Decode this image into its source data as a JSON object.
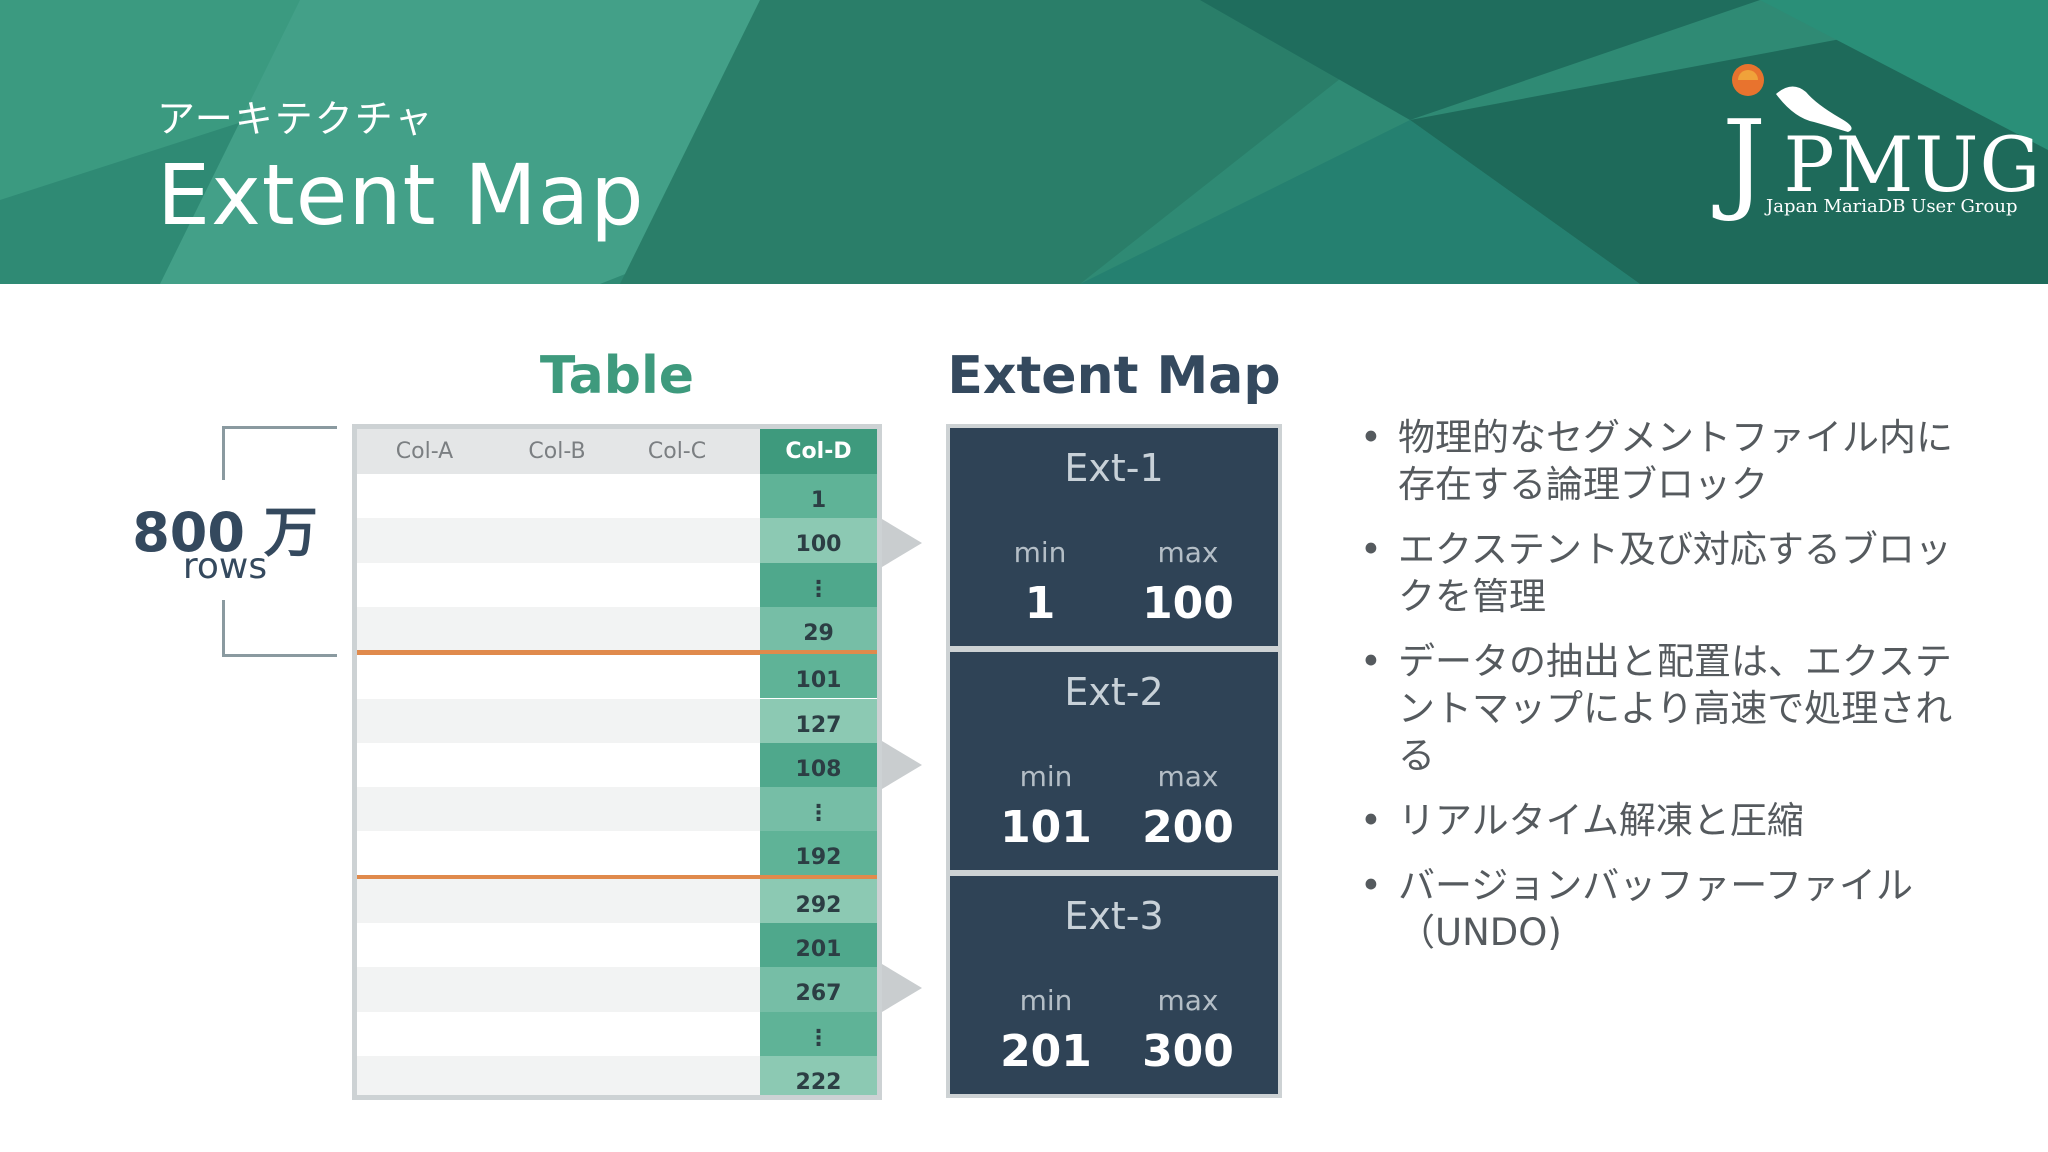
{
  "header": {
    "subtitle": "アーキテクチャ",
    "title": "Extent Map"
  },
  "logo": {
    "text": "JPMUG",
    "tagline": "Japan MariaDB User Group"
  },
  "diagram": {
    "table_heading": "Table",
    "extent_map_heading": "Extent Map",
    "row_count": "800 万",
    "row_unit": "rows",
    "columns": [
      "Col-A",
      "Col-B",
      "Col-C",
      "Col-D"
    ],
    "col_d_values": [
      "1",
      "100",
      "⋮",
      "29",
      "101",
      "127",
      "108",
      "⋮",
      "192",
      "292",
      "201",
      "267",
      "⋮",
      "222"
    ],
    "extents": [
      {
        "name": "Ext-1",
        "min_label": "min",
        "max_label": "max",
        "min": "1",
        "max": "100"
      },
      {
        "name": "Ext-2",
        "min_label": "min",
        "max_label": "max",
        "min": "101",
        "max": "200"
      },
      {
        "name": "Ext-3",
        "min_label": "min",
        "max_label": "max",
        "min": "201",
        "max": "300"
      }
    ],
    "colors": {
      "accent_green": "#3e9a7d",
      "extent_navy": "#2f4356",
      "separator_orange": "#e08a4c"
    }
  },
  "bullets": [
    "物理的なセグメントファイル内に存在する論理ブロック",
    "エクステント及び対応するブロックを管理",
    "データの抽出と配置は、エクステントマップにより高速で処理される",
    "リアルタイム解凍と圧縮",
    "バージョンバッファーファイル（UNDO)"
  ]
}
